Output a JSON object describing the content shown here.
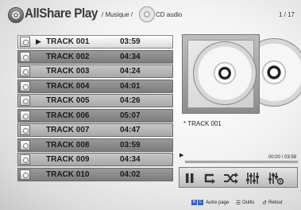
{
  "header": {
    "title": "AllShare Play",
    "breadcrumb": [
      "/ Musique /",
      "CD audio"
    ],
    "page_indicator": "1 / 17"
  },
  "tracks": [
    {
      "name": "TRACK 001",
      "time": "03:59",
      "playing": true
    },
    {
      "name": "TRACK 002",
      "time": "04:34",
      "playing": false
    },
    {
      "name": "TRACK 003",
      "time": "04:24",
      "playing": false
    },
    {
      "name": "TRACK 004",
      "time": "04:01",
      "playing": false
    },
    {
      "name": "TRACK 005",
      "time": "04:26",
      "playing": false
    },
    {
      "name": "TRACK 006",
      "time": "05:07",
      "playing": false
    },
    {
      "name": "TRACK 007",
      "time": "04:47",
      "playing": false
    },
    {
      "name": "TRACK 008",
      "time": "03:59",
      "playing": false
    },
    {
      "name": "TRACK 009",
      "time": "04:34",
      "playing": false
    },
    {
      "name": "TRACK 010",
      "time": "04:02",
      "playing": false
    }
  ],
  "player": {
    "now_playing_label": "* TRACK 001",
    "time_readout": "00:00 / 03:59",
    "progress": 0.0,
    "controls": [
      "pause-icon",
      "repeat-icon",
      "shuffle-icon",
      "equalizer-icon",
      "equalizer-settings-icon"
    ]
  },
  "footer": {
    "keys": [
      {
        "label": "B",
        "color": "#3a5fb8"
      },
      {
        "label": "C",
        "color": "#3a5fb8"
      }
    ],
    "page_label": "Autre page",
    "tools_label": "Outils",
    "return_label": "Retour"
  }
}
